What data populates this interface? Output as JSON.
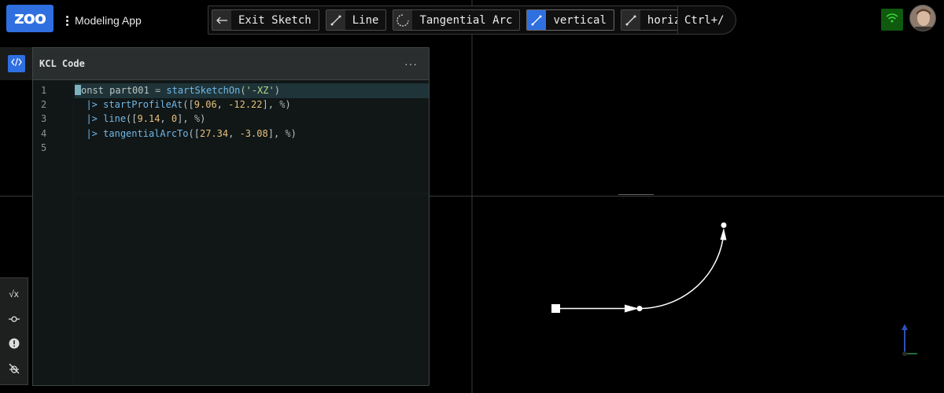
{
  "app": {
    "logo": "zoo",
    "menu_label": "Modeling App"
  },
  "toolbar": {
    "tools": [
      {
        "label": "Exit Sketch",
        "icon": "arrow-left-icon",
        "active": false
      },
      {
        "label": "Line",
        "icon": "line-icon",
        "active": false
      },
      {
        "label": "Tangential Arc",
        "icon": "tangential-arc-icon",
        "active": false
      },
      {
        "label": "vertical",
        "icon": "vertical-constraint-icon",
        "active": true
      },
      {
        "label": "horizontal",
        "icon": "horizontal-constraint-icon",
        "active": false
      }
    ],
    "shortcut": "Ctrl+/"
  },
  "status": {
    "network_icon": "wifi-icon",
    "network_color": "#0f5a0f"
  },
  "code_pane": {
    "title": "KCL Code",
    "menu_glyph": "···",
    "line_numbers": [
      "1",
      "2",
      "3",
      "4",
      "5"
    ],
    "lines": [
      "const part001 = startSketchOn('-XZ')",
      "  |> startProfileAt([9.06, -12.22], %)",
      "  |> line([9.14, 0], %)",
      "  |> tangentialArcTo([27.34, -3.08], %)",
      ""
    ]
  },
  "side_tools": [
    {
      "icon": "sqrt-x-icon",
      "glyph": "√x"
    },
    {
      "icon": "commit-node-icon",
      "glyph": ""
    },
    {
      "icon": "alert-circle-icon",
      "glyph": "!"
    },
    {
      "icon": "bug-off-icon",
      "glyph": ""
    }
  ],
  "colors": {
    "accent": "#2f6fe0",
    "background": "#000000",
    "code_bg": "#111616"
  }
}
